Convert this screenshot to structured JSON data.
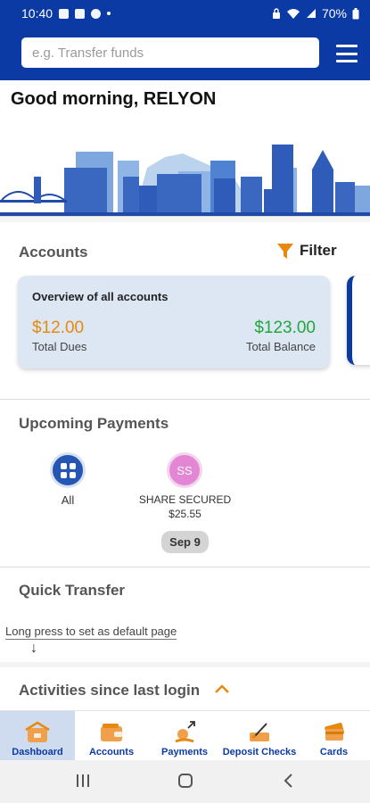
{
  "status_bar": {
    "time": "10:40",
    "battery": "70%"
  },
  "search": {
    "placeholder": "e.g. Transfer funds"
  },
  "greeting": "Good morning, RELYON",
  "accounts": {
    "title": "Accounts",
    "filter_label": "Filter",
    "overview_title": "Overview of all accounts",
    "total_dues_value": "$12.00",
    "total_dues_label": "Total Dues",
    "total_balance_value": "$123.00",
    "total_balance_label": "Total Balance"
  },
  "upcoming_payments": {
    "title": "Upcoming Payments",
    "all_label": "All",
    "payees": [
      {
        "initials": "SS",
        "name": "SHARE SECURED",
        "amount": "$25.55",
        "date": "Sep 9"
      }
    ]
  },
  "quick_transfer": {
    "title": "Quick Transfer",
    "hint": "Long press to set as default page"
  },
  "activities": {
    "title": "Activities since last login"
  },
  "bottom_nav": [
    {
      "label": "Dashboard",
      "icon": "house-icon",
      "active": true
    },
    {
      "label": "Accounts",
      "icon": "wallet-icon",
      "active": false
    },
    {
      "label": "Payments",
      "icon": "payments-icon",
      "active": false
    },
    {
      "label": "Deposit Checks",
      "icon": "check-deposit-icon",
      "active": false
    },
    {
      "label": "Cards",
      "icon": "cards-icon",
      "active": false
    }
  ],
  "colors": {
    "brand_blue": "#0b3aa5",
    "accent_orange": "#e58a0e",
    "balance_green": "#1fa83b",
    "avatar_pink": "#e387d4"
  }
}
